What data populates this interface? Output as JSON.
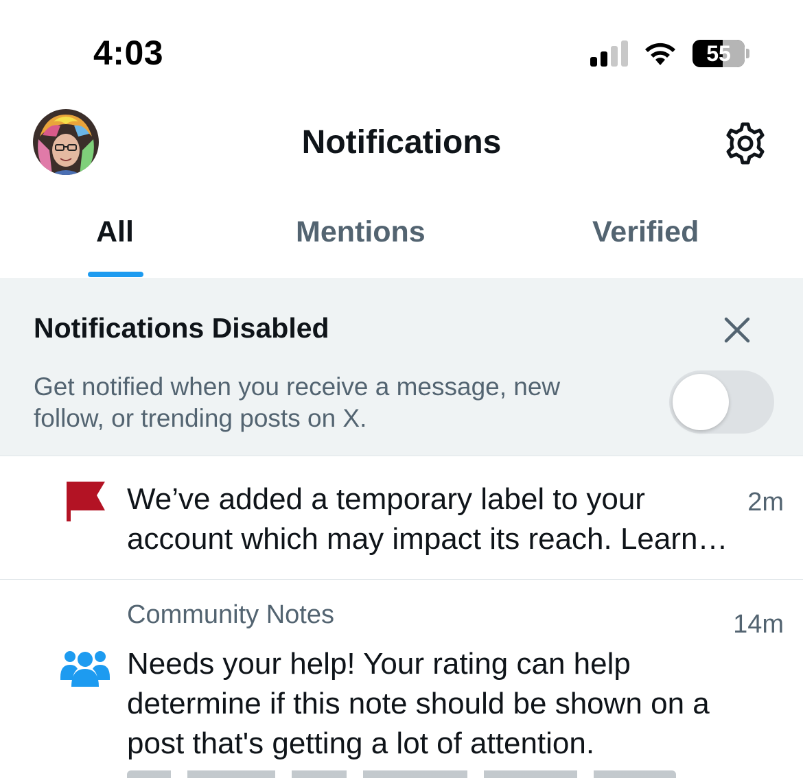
{
  "status_bar": {
    "time": "4:03",
    "battery_level": "55",
    "signal_bars_filled": 2,
    "signal_bars_total": 4
  },
  "header": {
    "title": "Notifications",
    "avatar_icon": "user-avatar",
    "settings_icon": "gear-icon"
  },
  "tabs": [
    {
      "label": "All",
      "active": true
    },
    {
      "label": "Mentions",
      "active": false
    },
    {
      "label": "Verified",
      "active": false
    }
  ],
  "banner": {
    "title": "Notifications Disabled",
    "description": "Get notified when you receive a message, new follow, or trending posts on X.",
    "toggle_on": false,
    "close_icon": "close-icon"
  },
  "notifications": [
    {
      "icon": "flag-icon",
      "icon_color": "#b31324",
      "text": "We’ve added a temporary label to your account which may impact its reach. Learn…",
      "time": "2m"
    },
    {
      "icon": "people-icon",
      "icon_color": "#1d9bf0",
      "source": "Community Notes",
      "text": "Needs your help! Your rating can help determine if this note should be shown on a post that's getting a lot of attention.",
      "time": "14m"
    }
  ],
  "colors": {
    "accent": "#1d9bf0",
    "text_primary": "#0f1419",
    "text_secondary": "#536471",
    "banner_bg": "#eff3f4"
  }
}
